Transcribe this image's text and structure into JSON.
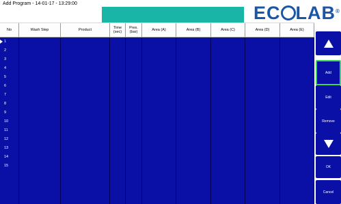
{
  "window": {
    "title": "Add Program - 14-01-17 - 13:29:00",
    "brand": {
      "pre": "EC",
      "post": "LAB",
      "reg": "®"
    }
  },
  "colors": {
    "grid_bg": "#0a10a6",
    "accent": "#19b6a8",
    "brand": "#1a56a5",
    "active": "#3bd94a"
  },
  "table": {
    "columns": [
      {
        "label": "No"
      },
      {
        "label": "Wash Step"
      },
      {
        "label": "Product"
      },
      {
        "label": "Time (sec)"
      },
      {
        "label": "Pres. (bar)"
      },
      {
        "label": "Area (A)"
      },
      {
        "label": "Area (B)"
      },
      {
        "label": "Area (C)"
      },
      {
        "label": "Area (D)"
      },
      {
        "label": "Area (E)"
      }
    ],
    "rows": [
      "1",
      "2",
      "3",
      "4",
      "5",
      "6",
      "7",
      "8",
      "9",
      "10",
      "11",
      "12",
      "13",
      "14",
      "15"
    ]
  },
  "sidebar": {
    "up_icon": "arrow-up-icon",
    "add": "Add",
    "edit": "Edit",
    "remove": "Remove",
    "down_icon": "arrow-down-icon",
    "ok": "OK",
    "cancel": "Cancel"
  }
}
